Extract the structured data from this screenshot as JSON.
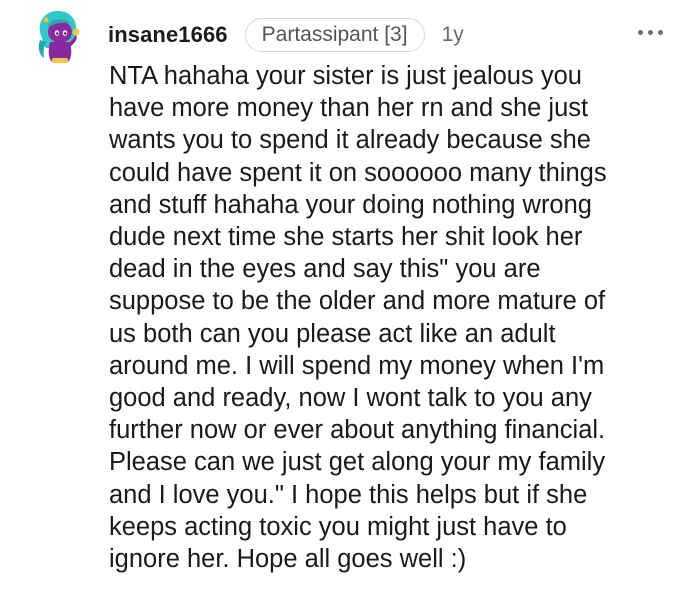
{
  "comment": {
    "author": "insane1666",
    "flair": "Partassipant [3]",
    "age": "1y",
    "more_icon": "more-horizontal-icon",
    "avatar_icon": "snoo-avatar-icon",
    "body_lines": [
      "NTA hahaha your sister is just jealous you",
      "have more money than her rn and she just",
      "wants you to spend it already because she",
      "could have spent it on soooooo many things",
      "and stuff hahaha your doing nothing wrong",
      "dude next time she starts her shit look her",
      "dead in the eyes and say this\" you are",
      "suppose to be the older and more mature of",
      "us both can you please act like an adult",
      "around me. I will spend my money when I'm",
      "good and ready, now I wont talk to you any",
      "further now or ever about anything financial.",
      "Please can we just get along your my family",
      "and I love you.\" I hope this helps but if she",
      "keeps acting toxic you might just have to",
      "ignore her. Hope all goes well :)"
    ]
  },
  "colors": {
    "avatar_body": "#8b2a9e",
    "avatar_hair": "#35c6c9",
    "avatar_accent": "#f2c94c"
  }
}
